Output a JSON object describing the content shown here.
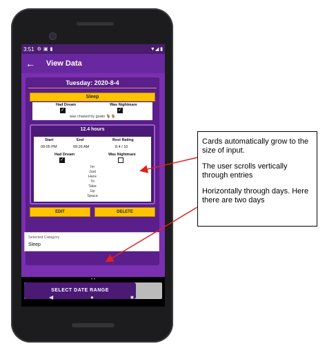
{
  "status": {
    "time": "3:51"
  },
  "appbar": {
    "back_icon": "arrow-left-icon",
    "title": "View Data"
  },
  "day": {
    "header": "Tuesday: 2020-8-4"
  },
  "category_bar": "Sleep",
  "entry1": {
    "had_dream_label": "Had Dream",
    "was_nightmare_label": "Was Nightmare",
    "had_dream": true,
    "was_nightmare": true,
    "description": "was chased by goats 🐐🐐"
  },
  "entry2": {
    "hours": "12.4 hours",
    "start_label": "Start",
    "end_label": "End",
    "rating_label": "Rest Rating",
    "start": "09:05 PM",
    "end": "09:26 AM",
    "rating": "8.4 / 10",
    "had_dream_label": "Had Dream",
    "was_nightmare_label": "Was Nightmare",
    "had_dream": true,
    "was_nightmare": false,
    "note_lines": [
      "Im",
      "Just",
      "Here",
      "To",
      "Take",
      "Up",
      "Space"
    ]
  },
  "buttons": {
    "edit": "EDIT",
    "delete": "DELETE"
  },
  "selected_category": {
    "label": "Selected Catagory",
    "value": "Sleep"
  },
  "pager_dots": "• •",
  "date_range_button": "SELECT DATE RANGE",
  "nav": {
    "back": "◀",
    "home": "●",
    "recents": "■"
  },
  "annotation": {
    "p1": "Cards automatically grow to the size of input.",
    "p2": "The user scrolls vertically through entries",
    "p3": "Horizontally through days. Here there are two days"
  },
  "colors": {
    "purple_dark": "#4b1a75",
    "purple": "#7a2fb0",
    "yellow": "#ffc400",
    "arrow": "#e02020"
  }
}
